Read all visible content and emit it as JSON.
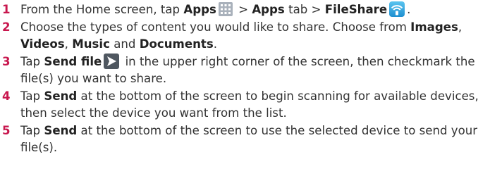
{
  "steps": [
    {
      "num": "1",
      "t1": "From the Home screen, tap ",
      "b1": "Apps",
      "icon1": "apps-grid-icon",
      "t2": " > ",
      "b2": "Apps",
      "t3": " tab > ",
      "b3": "FileShare",
      "icon2": "fileshare-wifi-icon",
      "t4": "."
    },
    {
      "num": "2",
      "t1": "Choose the types of content you would like to share. Choose from ",
      "b1": "Images",
      "t2": ", ",
      "b2": "Videos",
      "t3": ", ",
      "b3": "Music",
      "t4": " and ",
      "b4": "Documents",
      "t5": "."
    },
    {
      "num": "3",
      "t1": "Tap ",
      "b1": "Send file",
      "icon1": "send-arrow-icon",
      "t2": " in the upper right corner of the screen, then checkmark the file(s) you want to share."
    },
    {
      "num": "4",
      "t1": "Tap ",
      "b1": "Send",
      "t2": " at the bottom of the screen to begin scanning for available devices, then select the device you want from the list."
    },
    {
      "num": "5",
      "t1": "Tap ",
      "b1": "Send",
      "t2": " at the bottom of the screen to use the selected device to send your file(s)."
    }
  ],
  "colors": {
    "number": "#c8174e",
    "text": "#333333"
  }
}
